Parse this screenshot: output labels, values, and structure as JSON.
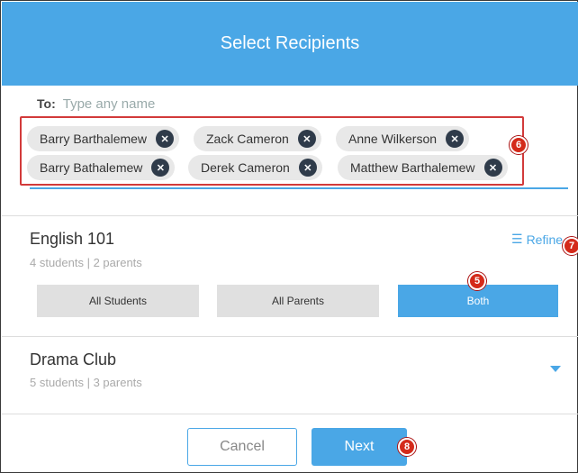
{
  "header": {
    "title": "Select Recipients"
  },
  "to_field": {
    "label": "To:",
    "placeholder": "Type any name"
  },
  "recipients": [
    "Barry Barthalemew",
    "Zack Cameron",
    "Anne Wilkerson",
    "Barry Bathalemew",
    "Derek Cameron",
    "Matthew Barthalemew"
  ],
  "chip_remove_glyph": "✕",
  "groups": [
    {
      "title": "English 101",
      "subtitle": "4 students | 2 parents",
      "refine_label": "Refine",
      "options": [
        "All Students",
        "All Parents",
        "Both"
      ],
      "selected_option": "Both"
    },
    {
      "title": "Drama Club",
      "subtitle": "5 students | 3 parents"
    }
  ],
  "buttons": {
    "cancel": "Cancel",
    "next": "Next"
  },
  "callouts": {
    "chips": "6",
    "refine": "7",
    "both": "5",
    "next": "8"
  },
  "colors": {
    "accent": "#4aa7e6",
    "callout": "#d42a1a",
    "highlight_box": "#d23a3a",
    "chip_bg": "#e8e8e8",
    "chip_x": "#2f3b4a"
  }
}
